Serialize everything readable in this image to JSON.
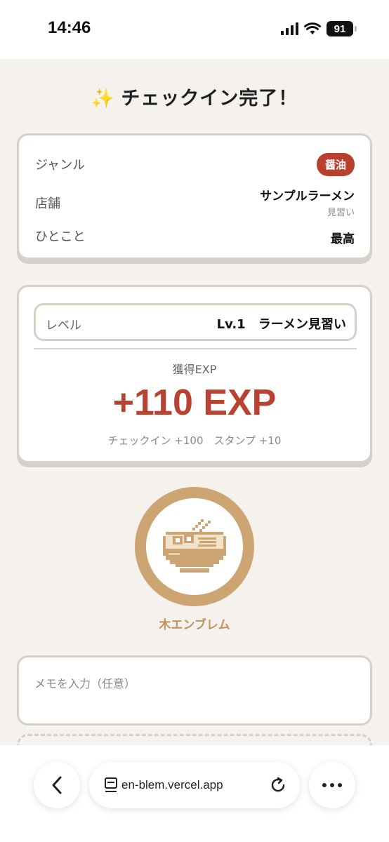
{
  "status_bar": {
    "time": "14:46",
    "battery": "91",
    "icons": [
      "signal-icon",
      "wifi-icon",
      "battery-icon"
    ]
  },
  "title": {
    "sparkle": "✨",
    "text": "チェックイン完了！"
  },
  "info": {
    "genre_label": "ジャンル",
    "genre_value": "醤油",
    "shop_label": "店舗",
    "shop_name": "サンプルラーメン",
    "shop_sub": "見習い",
    "comment_label": "ひとこと",
    "comment_value": "最高"
  },
  "exp": {
    "level_label": "レベル",
    "level_value": "Lv.1　ラーメン見習い",
    "gained_label": "獲得EXP",
    "gained_value": "+110 EXP",
    "breakdown": "チェックイン +100　スタンプ +10"
  },
  "emblem": {
    "icon": "ramen-bowl-icon",
    "name": "木エンブレム"
  },
  "memo": {
    "placeholder": "メモを入力（任意）",
    "value": ""
  },
  "browser": {
    "url": "en-blem.vercel.app"
  },
  "colors": {
    "accent": "#b84332",
    "badge": "#b9402f",
    "emblem": "#cda572",
    "background": "#f5f1ec",
    "border": "#d6d0c8"
  }
}
